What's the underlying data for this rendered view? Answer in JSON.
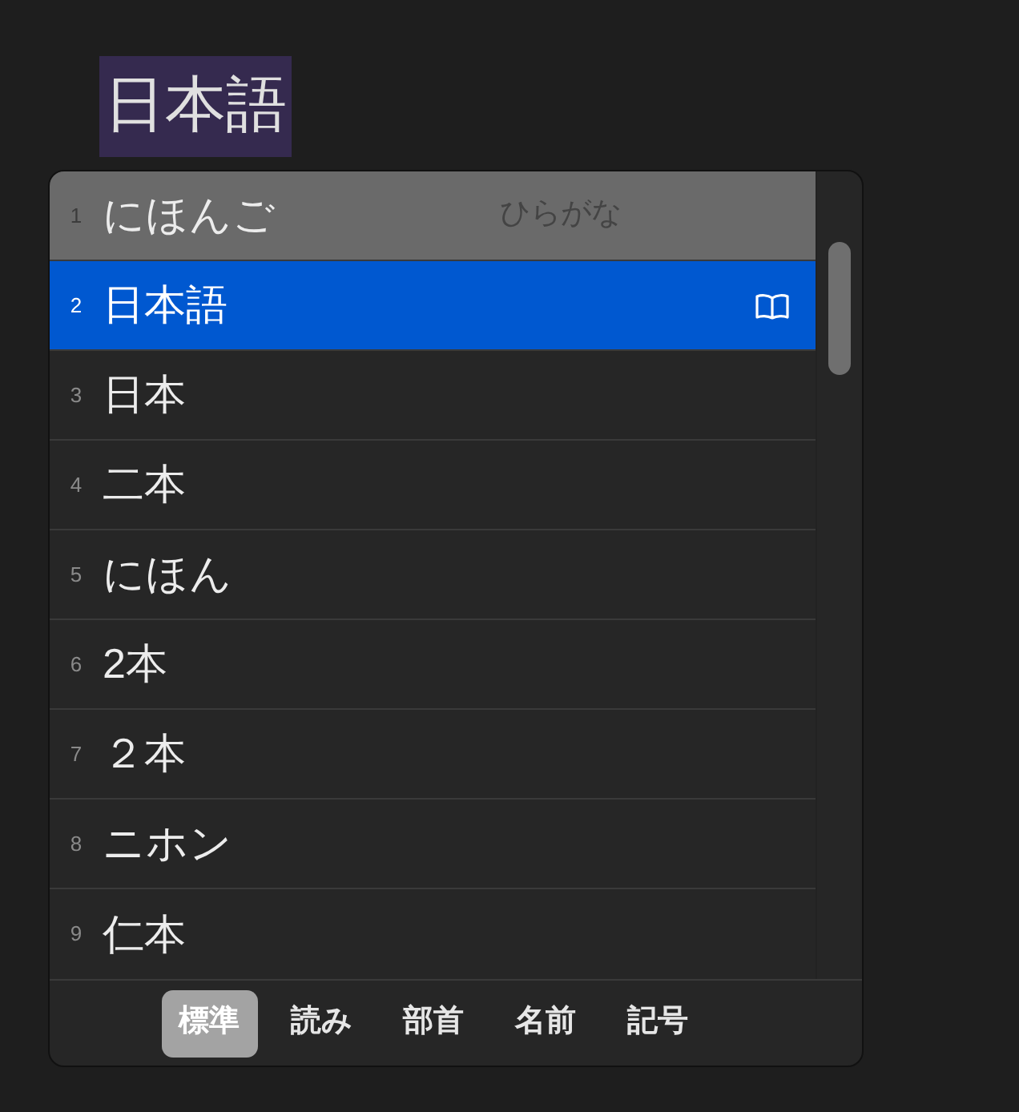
{
  "composition": {
    "text": "日本語"
  },
  "candidates": [
    {
      "number": "1",
      "text": "にほんご",
      "annotation": "ひらがな",
      "highlighted": true,
      "selected": false,
      "dictionary": false
    },
    {
      "number": "2",
      "text": "日本語",
      "highlighted": false,
      "selected": true,
      "dictionary": true
    },
    {
      "number": "3",
      "text": "日本",
      "highlighted": false,
      "selected": false,
      "dictionary": false
    },
    {
      "number": "4",
      "text": "二本",
      "highlighted": false,
      "selected": false,
      "dictionary": false
    },
    {
      "number": "5",
      "text": "にほん",
      "highlighted": false,
      "selected": false,
      "dictionary": false
    },
    {
      "number": "6",
      "text": "2本",
      "highlighted": false,
      "selected": false,
      "dictionary": false
    },
    {
      "number": "7",
      "text": "２本",
      "highlighted": false,
      "selected": false,
      "dictionary": false
    },
    {
      "number": "8",
      "text": "ニホン",
      "highlighted": false,
      "selected": false,
      "dictionary": false
    },
    {
      "number": "9",
      "text": "仁本",
      "highlighted": false,
      "selected": false,
      "dictionary": false
    }
  ],
  "tabs": [
    {
      "label": "標準",
      "selected": true
    },
    {
      "label": "読み",
      "selected": false
    },
    {
      "label": "部首",
      "selected": false
    },
    {
      "label": "名前",
      "selected": false
    },
    {
      "label": "記号",
      "selected": false
    }
  ]
}
